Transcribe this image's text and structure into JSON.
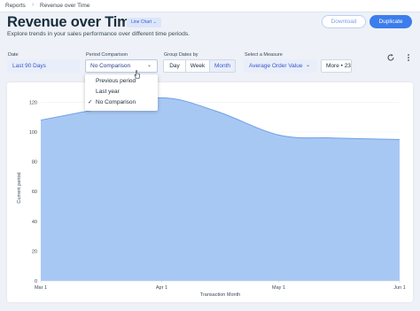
{
  "breadcrumb": {
    "items": [
      "Reports",
      "Revenue over Time"
    ],
    "separator": "›"
  },
  "page": {
    "title": "Revenue over Time",
    "type_badge": "Line Chart ⌄",
    "subtitle": "Explore trends in your sales performance over different time periods."
  },
  "header_actions": {
    "download_label": "Download",
    "duplicate_label": "Duplicate"
  },
  "filters": {
    "date": {
      "label": "Date",
      "value": "Last 90 Days"
    },
    "period_comparison": {
      "label": "Period Comparison",
      "value": "No Comparison",
      "caret": "⌄",
      "options": [
        "Previous period",
        "Last year",
        "No Comparison"
      ],
      "selected": "No Comparison",
      "check_icon": "✓"
    },
    "group_dates_by": {
      "label": "Group Dates by",
      "options": [
        "Day",
        "Week",
        "Month"
      ],
      "selected": "Month"
    },
    "measure": {
      "label": "Select a Measure",
      "value": "Average Order Value",
      "caret": "⌄"
    },
    "more_label": "More • 23"
  },
  "icons": {
    "refresh": "refresh-icon",
    "menu": "kebab-menu-icon",
    "cursor": "text-cursor-icon"
  },
  "colors": {
    "accent": "#3b7dec",
    "area_fill": "#a8c8f4",
    "area_line": "#6d9fe6",
    "selected_bg": "#e8eefa",
    "selected_text": "#3a56c8"
  },
  "chart_data": {
    "type": "area",
    "x": [
      "2024-03-01",
      "2024-03-15",
      "2024-04-01",
      "2024-04-15",
      "2024-05-01",
      "2024-05-15",
      "2024-06-01"
    ],
    "x_tick_labels": [
      "Mar 1",
      "Apr 1",
      "May 1",
      "Jun 1"
    ],
    "series": [
      {
        "values": [
          108,
          115,
          123,
          114,
          98,
          96,
          95
        ]
      }
    ],
    "y_ticks": [
      0,
      20,
      40,
      60,
      80,
      100,
      120
    ],
    "ylim": [
      0,
      125
    ],
    "xlabel": "Transaction Month",
    "ylabel": "Current period",
    "grid": true,
    "title": ""
  }
}
